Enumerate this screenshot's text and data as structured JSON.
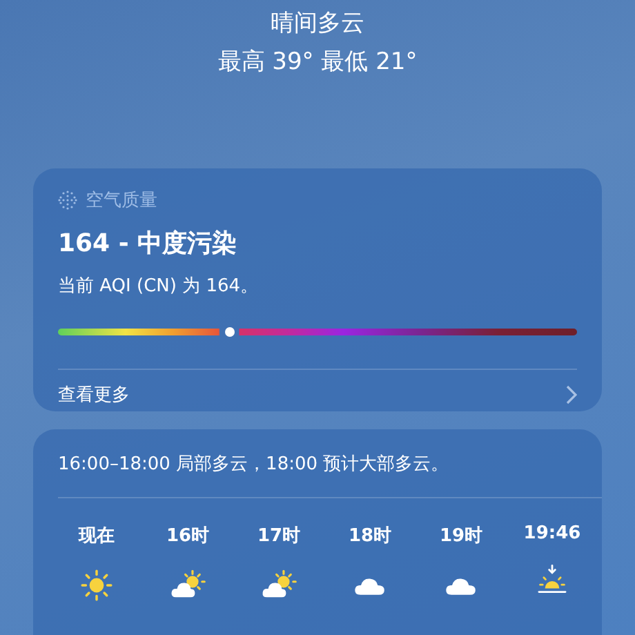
{
  "header": {
    "condition": "晴间多云",
    "high_low": "最高 39°  最低 21°"
  },
  "air_quality": {
    "title": "空气质量",
    "headline": "164 - 中度污染",
    "description": "当前 AQI (CN) 为 164。",
    "level": 0.33,
    "more_link": "查看更多"
  },
  "hourly": {
    "summary": "16:00–18:00 局部多云，18:00 预计大部多云。",
    "hours": [
      {
        "label": "现在",
        "kind": "sun"
      },
      {
        "label": "16时",
        "kind": "partly-cloudy"
      },
      {
        "label": "17时",
        "kind": "partly-cloudy"
      },
      {
        "label": "18时",
        "kind": "cloud"
      },
      {
        "label": "19时",
        "kind": "cloud"
      },
      {
        "label": "19:46",
        "kind": "sunset"
      }
    ]
  }
}
